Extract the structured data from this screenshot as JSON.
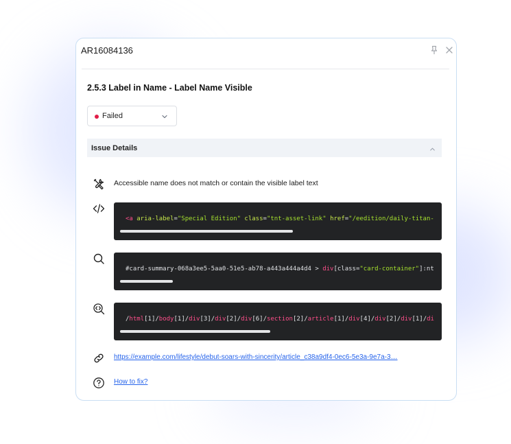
{
  "card": {
    "id": "AR16084136",
    "rule_title": "2.5.3 Label in Name - Label Name Visible",
    "status": {
      "label": "Failed",
      "color": "#e11d48"
    },
    "section": {
      "title": "Issue Details"
    },
    "issue_text": "Accessible name does not match or contain the visible label text",
    "snippet": {
      "open": "<",
      "tag": "a",
      "attr1": "aria-label",
      "eq1": "=",
      "val1": "\"Special Edition\"",
      "attr2": "class",
      "eq2": "=",
      "val2": "\"tnt-asset-link\"",
      "attr3": "href",
      "eq3": "=",
      "val3": "\"/eedition/daily-titan-"
    },
    "selector": {
      "prefix": "#card-summary-068a3ee5-5aa0-51e5-ab78-a443a444a4d4 > ",
      "tag": "div",
      "bracket_open": "[class=",
      "val": "\"card-container\"",
      "suffix": "]:nt"
    },
    "xpath": [
      {
        "tag": "html",
        "index": "[1]"
      },
      {
        "tag": "body",
        "index": "[1]"
      },
      {
        "tag": "div",
        "index": "[3]"
      },
      {
        "tag": "div",
        "index": "[2]"
      },
      {
        "tag": "div",
        "index": "[6]"
      },
      {
        "tag": "section",
        "index": "[2]"
      },
      {
        "tag": "article",
        "index": "[1]"
      },
      {
        "tag": "div",
        "index": "[4]"
      },
      {
        "tag": "div",
        "index": "[2]"
      },
      {
        "tag": "div",
        "index": "[1]"
      },
      {
        "tag": "di",
        "index": ""
      }
    ],
    "url": "https://example.com/lifestyle/debut-soars-with-sincerity/article_c38a9df4-0ec6-5e3a-9e7a-3…",
    "how_to_fix": "How to fix?"
  },
  "icons": {
    "pin": "pin-icon",
    "close": "close-icon",
    "tools": "tools-icon",
    "code": "code-icon",
    "search": "search-icon",
    "xpath": "zoom-code-icon",
    "link": "link-icon",
    "help": "help-circle-icon"
  }
}
